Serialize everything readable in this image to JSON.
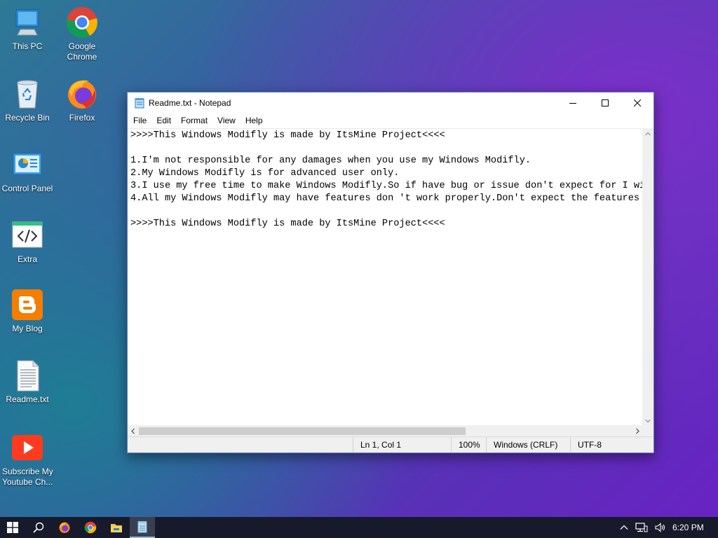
{
  "desktop": {
    "icons": [
      {
        "label": "This PC"
      },
      {
        "label": "Google Chrome"
      },
      {
        "label": "Recycle Bin"
      },
      {
        "label": "Firefox"
      },
      {
        "label": "Control Panel"
      },
      {
        "label": "Extra"
      },
      {
        "label": "My Blog"
      },
      {
        "label": "Readme.txt"
      },
      {
        "label": "Subscribe My Youtube Ch..."
      }
    ]
  },
  "window": {
    "title": "Readme.txt - Notepad",
    "menu": [
      "File",
      "Edit",
      "Format",
      "View",
      "Help"
    ],
    "content": ">>>>This Windows Modifly is made by ItsMine Project<<<<\n\n1.I'm not responsible for any damages when you use my Windows Modifly.\n2.My Windows Modifly is for advanced user only.\n3.I use my free time to make Windows Modifly.So if have bug or issue don't expect for I wil\n4.All my Windows Modifly may have features don 't work properly.Don't expect the features y\n\n>>>>This Windows Modifly is made by ItsMine Project<<<<",
    "status": {
      "position": "Ln 1, Col 1",
      "zoom": "100%",
      "line_ending": "Windows (CRLF)",
      "encoding": "UTF-8"
    }
  },
  "taskbar": {
    "clock": "6:20 PM"
  },
  "colors": {
    "window_border": "#5a7fb8",
    "taskbar_bg": "#161a2a"
  }
}
